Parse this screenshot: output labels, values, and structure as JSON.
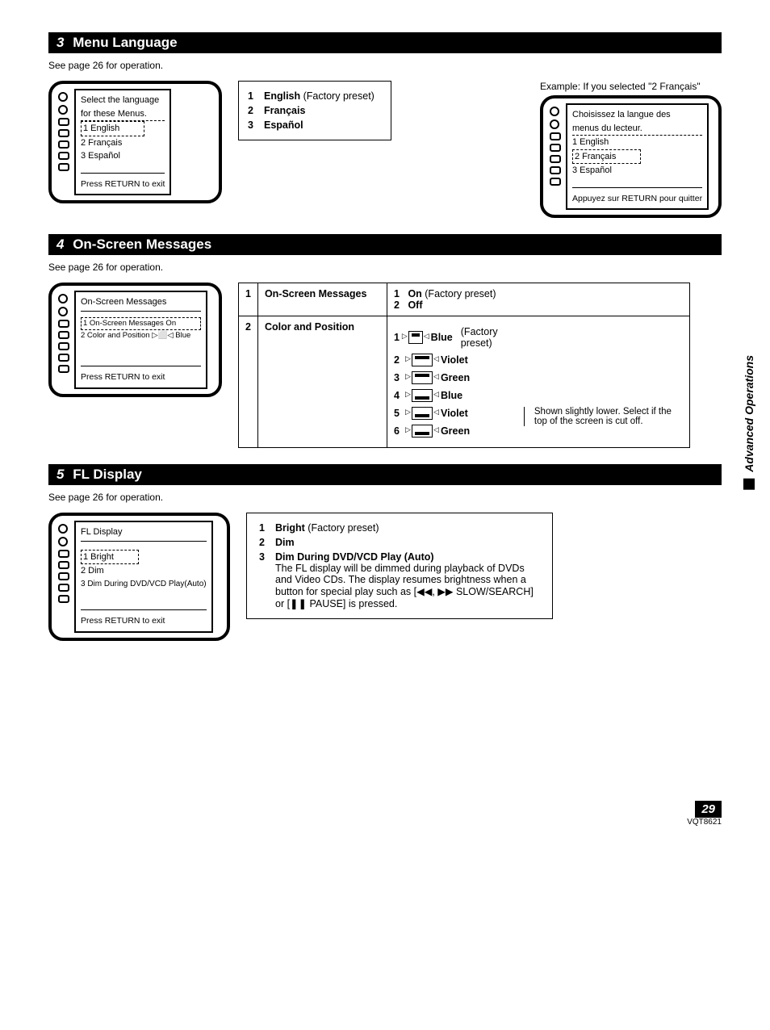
{
  "sideTab": "Advanced Operations",
  "pageNumber": "29",
  "docCode": "VQT8621",
  "sections": {
    "menuLang": {
      "num": "3",
      "title": "Menu Language",
      "note": "See page 26 for operation.",
      "exampleLabel": "Example: If you selected \"2 Français\"",
      "screenA": {
        "line1": "Select the language",
        "line2": "for these Menus.",
        "opt1": "1  English",
        "opt2": "2  Français",
        "opt3": "3  Español",
        "footer": "Press RETURN to exit"
      },
      "screenB": {
        "line1": "Choisissez la langue des",
        "line2": "menus du lecteur.",
        "opt1": "1  English",
        "opt2": "2  Français",
        "opt3": "3  Español",
        "footer": "Appuyez sur RETURN pour quitter"
      },
      "options": {
        "n1": "1",
        "l1": "English",
        "s1": " (Factory preset)",
        "n2": "2",
        "l2": "Français",
        "n3": "3",
        "l3": "Español"
      }
    },
    "onScreen": {
      "num": "4",
      "title": "On-Screen Messages",
      "note": "See page 26 for operation.",
      "screen": {
        "heading": "On-Screen Messages",
        "line1": "1 On-Screen Messages   On",
        "line2": "2 Color and Position ▷⬜◁ Blue",
        "footer": "Press RETURN to exit"
      },
      "table": {
        "r1n": "1",
        "r1label": "On-Screen Messages",
        "r1o1n": "1",
        "r1o1": "On",
        "r1o1s": " (Factory preset)",
        "r1o2n": "2",
        "r1o2": "Off",
        "r2n": "2",
        "r2label": "Color and Position",
        "colors": {
          "c1n": "1",
          "c1": "Blue",
          "c1s": " (Factory preset)",
          "c2n": "2",
          "c2": "Violet",
          "c3n": "3",
          "c3": "Green",
          "c4n": "4",
          "c4": "Blue",
          "c5n": "5",
          "c5": "Violet",
          "c6n": "6",
          "c6": "Green"
        },
        "bracketNote": "Shown slightly lower. Select if the top of the screen is cut off."
      }
    },
    "flDisplay": {
      "num": "5",
      "title": "FL Display",
      "note": "See page 26 for operation.",
      "screen": {
        "heading": "FL Display",
        "line1": "1 Bright",
        "line2": "2 Dim",
        "line3": "3 Dim During DVD/VCD Play(Auto)",
        "footer": "Press RETURN to exit"
      },
      "options": {
        "n1": "1",
        "l1": "Bright",
        "s1": " (Factory preset)",
        "n2": "2",
        "l2": "Dim",
        "n3": "3",
        "l3": "Dim During DVD/VCD Play (Auto)",
        "desc": "The FL display will be dimmed during playback of DVDs and Video CDs. The display resumes brightness when a button for special play such as [◀◀, ▶▶ SLOW/SEARCH] or [❚❚ PAUSE] is pressed."
      }
    }
  }
}
